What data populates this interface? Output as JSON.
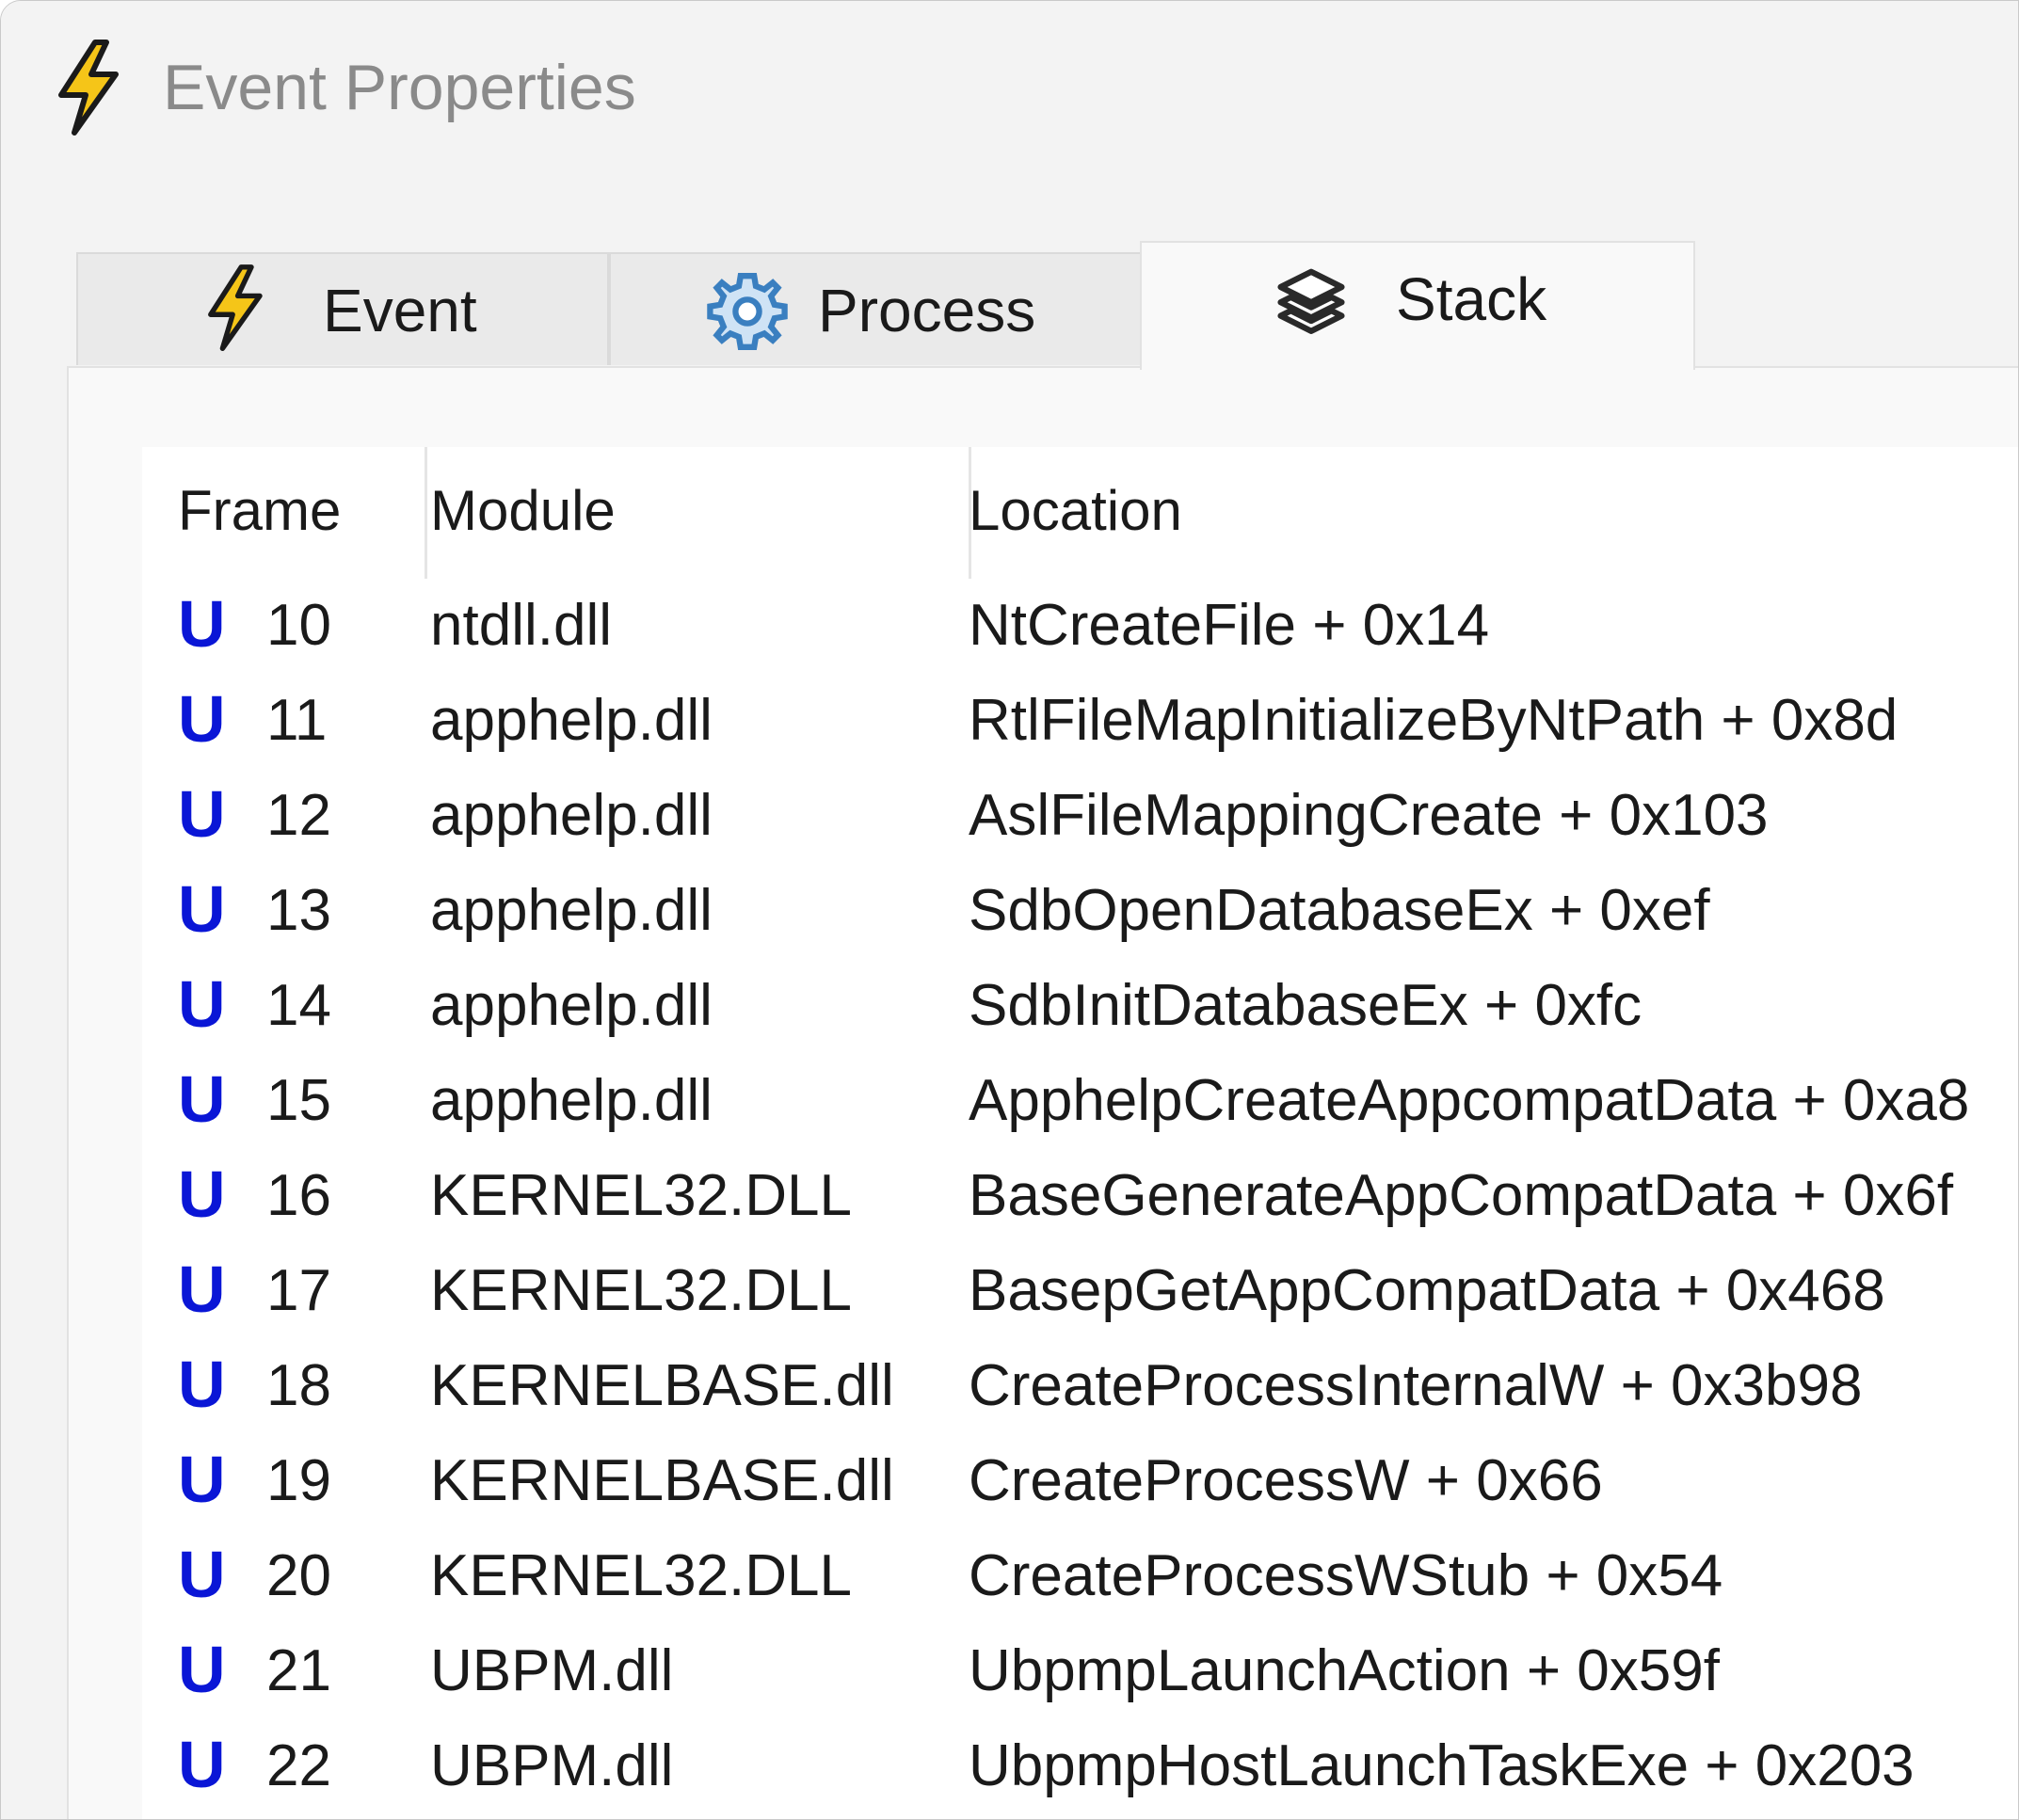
{
  "window": {
    "title": "Event Properties",
    "title_icon": "lightning-icon"
  },
  "tabs": [
    {
      "label": "Event",
      "icon": "lightning-icon",
      "active": false
    },
    {
      "label": "Process",
      "icon": "gear-icon",
      "active": false
    },
    {
      "label": "Stack",
      "icon": "layers-icon",
      "active": true
    }
  ],
  "stack_table": {
    "columns": [
      "Frame",
      "Module",
      "Location"
    ],
    "rows": [
      {
        "mode": "U",
        "frame": "10",
        "module": "ntdll.dll",
        "location": "NtCreateFile + 0x14"
      },
      {
        "mode": "U",
        "frame": "11",
        "module": "apphelp.dll",
        "location": "RtlFileMapInitializeByNtPath + 0x8d"
      },
      {
        "mode": "U",
        "frame": "12",
        "module": "apphelp.dll",
        "location": "AslFileMappingCreate + 0x103"
      },
      {
        "mode": "U",
        "frame": "13",
        "module": "apphelp.dll",
        "location": "SdbOpenDatabaseEx + 0xef"
      },
      {
        "mode": "U",
        "frame": "14",
        "module": "apphelp.dll",
        "location": "SdbInitDatabaseEx + 0xfc"
      },
      {
        "mode": "U",
        "frame": "15",
        "module": "apphelp.dll",
        "location": "ApphelpCreateAppcompatData + 0xa8"
      },
      {
        "mode": "U",
        "frame": "16",
        "module": "KERNEL32.DLL",
        "location": "BaseGenerateAppCompatData + 0x6f"
      },
      {
        "mode": "U",
        "frame": "17",
        "module": "KERNEL32.DLL",
        "location": "BasepGetAppCompatData + 0x468"
      },
      {
        "mode": "U",
        "frame": "18",
        "module": "KERNELBASE.dll",
        "location": "CreateProcessInternalW + 0x3b98"
      },
      {
        "mode": "U",
        "frame": "19",
        "module": "KERNELBASE.dll",
        "location": "CreateProcessW + 0x66"
      },
      {
        "mode": "U",
        "frame": "20",
        "module": "KERNEL32.DLL",
        "location": "CreateProcessWStub + 0x54"
      },
      {
        "mode": "U",
        "frame": "21",
        "module": "UBPM.dll",
        "location": "UbpmpLaunchAction + 0x59f"
      },
      {
        "mode": "U",
        "frame": "22",
        "module": "UBPM.dll",
        "location": "UbpmpHostLaunchTaskExe + 0x203"
      }
    ]
  },
  "colors": {
    "user_mode_badge": "#0a16d6",
    "lightning_fill": "#f5c518",
    "gear_fill": "#4a90c8"
  }
}
